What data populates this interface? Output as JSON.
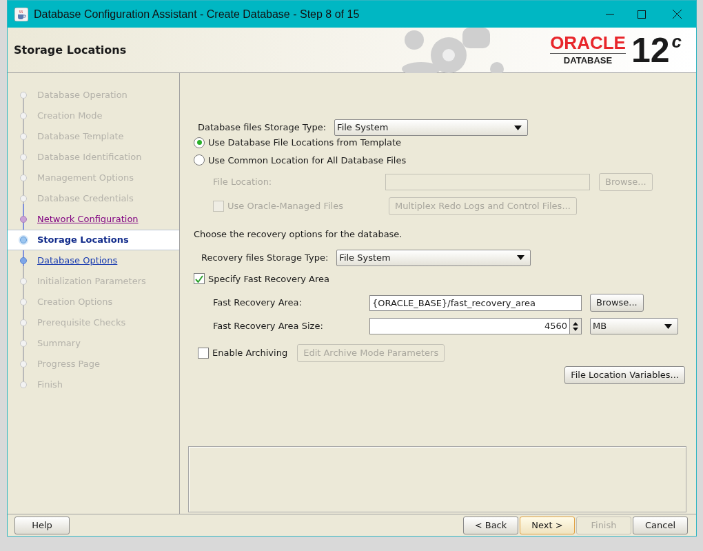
{
  "window": {
    "title": "Database Configuration Assistant - Create Database - Step 8 of 15"
  },
  "header": {
    "title": "Storage Locations",
    "logo": {
      "brand": "ORACLE",
      "product": "DATABASE",
      "version": "12",
      "version_suffix": "c"
    }
  },
  "steps": [
    {
      "label": "Database Operation",
      "kind": "done",
      "selected": false
    },
    {
      "label": "Creation Mode",
      "kind": "done",
      "selected": false
    },
    {
      "label": "Database Template",
      "kind": "done",
      "selected": false
    },
    {
      "label": "Database Identification",
      "kind": "done",
      "selected": false
    },
    {
      "label": "Management Options",
      "kind": "done",
      "selected": false
    },
    {
      "label": "Database Credentials",
      "kind": "done",
      "selected": false
    },
    {
      "label": "Network Configuration",
      "kind": "visited",
      "selected": false
    },
    {
      "label": "Storage Locations",
      "kind": "current",
      "selected": true
    },
    {
      "label": "Database Options",
      "kind": "link",
      "selected": false
    },
    {
      "label": "Initialization Parameters",
      "kind": "done",
      "selected": false
    },
    {
      "label": "Creation Options",
      "kind": "done",
      "selected": false
    },
    {
      "label": "Prerequisite Checks",
      "kind": "done",
      "selected": false
    },
    {
      "label": "Summary",
      "kind": "done",
      "selected": false
    },
    {
      "label": "Progress Page",
      "kind": "done",
      "selected": false
    },
    {
      "label": "Finish",
      "kind": "done",
      "selected": false
    }
  ],
  "form": {
    "storage_type": {
      "label": "Database files Storage Type:",
      "value": "File System"
    },
    "location_options": [
      {
        "label": "Use Database File Locations from Template",
        "selected": true
      },
      {
        "label": "Use Common Location for All Database Files",
        "selected": false
      }
    ],
    "file_location": {
      "label": "File Location:",
      "disabled": true,
      "button": "Browse..."
    },
    "oracle_managed": {
      "label": "Use Oracle-Managed Files",
      "checked": false,
      "disabled": true
    },
    "multiplex_button": {
      "label": "Multiplex Redo Logs and Control Files...",
      "disabled": true
    },
    "recovery_intro": "Choose the recovery options for the database.",
    "recovery_type": {
      "label": "Recovery files Storage Type:",
      "value": "File System"
    },
    "specify_fra": {
      "label": "Specify Fast Recovery Area",
      "checked": true
    },
    "fra": {
      "label": "Fast Recovery Area:",
      "value": "{ORACLE_BASE}/fast_recovery_area",
      "button": "Browse..."
    },
    "fra_size": {
      "label": "Fast Recovery Area Size:",
      "value": "4560",
      "unit": "MB"
    },
    "archiving": {
      "label": "Enable Archiving",
      "checked": false
    },
    "archive_params_button": {
      "label": "Edit Archive Mode Parameters",
      "disabled": true
    },
    "variables_button": {
      "label": "File Location Variables...",
      "disabled": false
    }
  },
  "buttons": [
    {
      "label": "Help",
      "kind": "help",
      "disabled": false,
      "focused": false
    },
    {
      "label": "< Back",
      "kind": "nav",
      "disabled": false,
      "focused": false
    },
    {
      "label": "Next >",
      "kind": "nav",
      "disabled": false,
      "focused": true
    },
    {
      "label": "Finish",
      "kind": "nav",
      "disabled": true,
      "focused": false
    },
    {
      "label": "Cancel",
      "kind": "nav",
      "disabled": false,
      "focused": false
    }
  ]
}
